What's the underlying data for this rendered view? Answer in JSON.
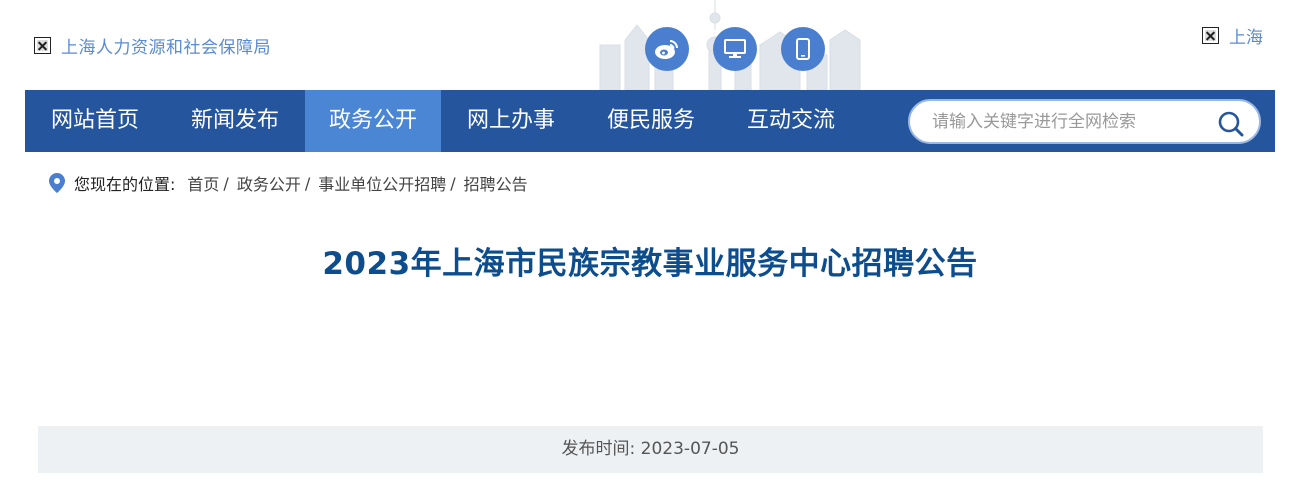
{
  "header": {
    "logo_text": "上海人力资源和社会保障局",
    "region_text": "上海",
    "icons": [
      "weibo-icon",
      "desktop-icon",
      "mobile-icon"
    ]
  },
  "nav": {
    "items": [
      {
        "label": "网站首页",
        "active": false
      },
      {
        "label": "新闻发布",
        "active": false
      },
      {
        "label": "政务公开",
        "active": true
      },
      {
        "label": "网上办事",
        "active": false
      },
      {
        "label": "便民服务",
        "active": false
      },
      {
        "label": "互动交流",
        "active": false
      }
    ],
    "search_placeholder": "请输入关键字进行全网检索"
  },
  "breadcrumb": {
    "label": "您现在的位置:",
    "items": [
      "首页",
      "政务公开",
      "事业单位公开招聘",
      "招聘公告"
    ],
    "separator": "/"
  },
  "article": {
    "title": "2023年上海市民族宗教事业服务中心招聘公告",
    "publish_label": "发布时间:",
    "publish_date": "2023-07-05"
  },
  "colors": {
    "nav_bg": "#24559d",
    "nav_active": "#4a86d3",
    "title": "#0d4d8d",
    "icon_bg": "#4a7fcf"
  }
}
